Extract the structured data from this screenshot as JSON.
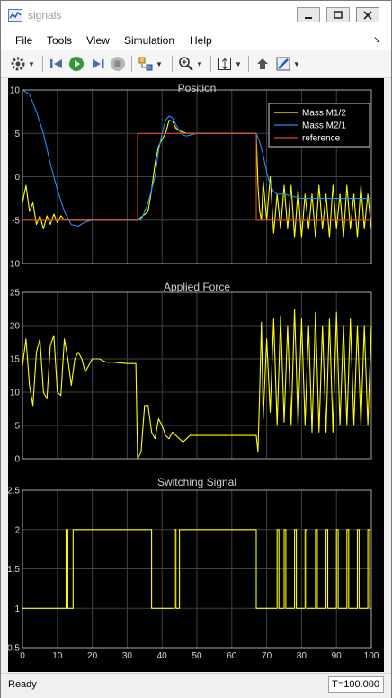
{
  "window": {
    "title": "signals"
  },
  "menu": [
    {
      "id": "file",
      "label": "File"
    },
    {
      "id": "tools",
      "label": "Tools"
    },
    {
      "id": "view",
      "label": "View"
    },
    {
      "id": "simulation",
      "label": "Simulation"
    },
    {
      "id": "help",
      "label": "Help"
    }
  ],
  "toolbar_icons": [
    "gear-icon",
    "step-back-icon",
    "run-icon",
    "step-forward-icon",
    "stop-icon",
    "layout-icon",
    "zoom-icon",
    "autoscale-icon",
    "highlight-block-icon",
    "style-icon"
  ],
  "colors": {
    "yellow": "#ffff00",
    "blue": "#1e90ff",
    "red": "#e0462b",
    "grid": "#404040",
    "axes_bg": "#000000"
  },
  "chart_data": [
    {
      "type": "line",
      "title": "Position",
      "xlim": [
        0,
        100
      ],
      "ylim": [
        -10,
        10
      ],
      "xticks": [
        0,
        10,
        20,
        30,
        40,
        50,
        60,
        70,
        80,
        90,
        100
      ],
      "yticks": [
        -10,
        -5,
        0,
        5,
        10
      ],
      "grid": true,
      "legend": "top-right",
      "series": [
        {
          "name": "Mass M1/2",
          "color": "#ffff00",
          "points": [
            [
              0,
              -3
            ],
            [
              1,
              -1
            ],
            [
              2,
              -4
            ],
            [
              3,
              -3
            ],
            [
              4,
              -5.5
            ],
            [
              5,
              -4.5
            ],
            [
              6,
              -6
            ],
            [
              7,
              -4.5
            ],
            [
              8,
              -5.5
            ],
            [
              9,
              -4.3
            ],
            [
              10,
              -5.3
            ],
            [
              11,
              -4.5
            ],
            [
              12,
              -5
            ],
            [
              14,
              -5
            ],
            [
              20,
              -5
            ],
            [
              33,
              -5
            ],
            [
              36,
              -4
            ],
            [
              37,
              -1.5
            ],
            [
              38,
              1.5
            ],
            [
              39,
              3.5
            ],
            [
              40,
              4.3
            ],
            [
              41,
              5
            ],
            [
              42,
              6.5
            ],
            [
              43,
              6.4
            ],
            [
              44,
              5.6
            ],
            [
              45,
              5.3
            ],
            [
              47,
              5
            ],
            [
              50,
              5
            ],
            [
              67,
              5
            ],
            [
              67.5,
              -1
            ],
            [
              68,
              -4
            ],
            [
              68.5,
              -5
            ],
            [
              69,
              -0.5
            ],
            [
              70,
              -5
            ],
            [
              71,
              0
            ],
            [
              72,
              -6.5
            ],
            [
              73,
              -2
            ],
            [
              74,
              -6
            ],
            [
              75,
              -1
            ],
            [
              76,
              -6
            ],
            [
              77,
              -1
            ],
            [
              78,
              -7
            ],
            [
              79,
              -1.5
            ],
            [
              80,
              -7
            ],
            [
              81,
              -2
            ],
            [
              82,
              -6
            ],
            [
              83,
              -2
            ],
            [
              84,
              -7
            ],
            [
              85,
              -1
            ],
            [
              86,
              -6
            ],
            [
              87,
              -2
            ],
            [
              88,
              -7
            ],
            [
              89,
              -1
            ],
            [
              90,
              -6
            ],
            [
              91,
              -2
            ],
            [
              92,
              -7
            ],
            [
              93,
              -1
            ],
            [
              94,
              -6
            ],
            [
              95,
              -2
            ],
            [
              96,
              -7
            ],
            [
              97,
              -1
            ],
            [
              98,
              -6
            ],
            [
              99,
              -2
            ],
            [
              100,
              -6
            ]
          ]
        },
        {
          "name": "Mass M2/1",
          "color": "#1e90ff",
          "points": [
            [
              0,
              10
            ],
            [
              2,
              9.5
            ],
            [
              4,
              7.5
            ],
            [
              6,
              5
            ],
            [
              8,
              1.5
            ],
            [
              10,
              -1.5
            ],
            [
              12,
              -4
            ],
            [
              14,
              -5.5
            ],
            [
              16,
              -5.7
            ],
            [
              18,
              -5.2
            ],
            [
              20,
              -5
            ],
            [
              25,
              -5
            ],
            [
              33,
              -5
            ],
            [
              34,
              -5
            ],
            [
              36,
              -3
            ],
            [
              38,
              0
            ],
            [
              39,
              3
            ],
            [
              40,
              5
            ],
            [
              41,
              6.5
            ],
            [
              42,
              7
            ],
            [
              43,
              6.8
            ],
            [
              44,
              6
            ],
            [
              45,
              5.3
            ],
            [
              46,
              4.8
            ],
            [
              47,
              4.7
            ],
            [
              48,
              4.8
            ],
            [
              50,
              5
            ],
            [
              55,
              5
            ],
            [
              67,
              5
            ],
            [
              68,
              4
            ],
            [
              69,
              2.5
            ],
            [
              70,
              0.5
            ],
            [
              71,
              -1
            ],
            [
              72,
              -1.7
            ],
            [
              73,
              -2
            ],
            [
              75,
              -2
            ],
            [
              80,
              -2.5
            ],
            [
              90,
              -2.5
            ],
            [
              100,
              -2.5
            ]
          ]
        },
        {
          "name": "reference",
          "color": "#e0462b",
          "points": [
            [
              0,
              -5
            ],
            [
              33,
              -5
            ],
            [
              33,
              5
            ],
            [
              67,
              5
            ],
            [
              67,
              -5
            ],
            [
              100,
              -5
            ]
          ]
        }
      ]
    },
    {
      "type": "line",
      "title": "Applied Force",
      "xlim": [
        0,
        100
      ],
      "ylim": [
        0,
        25
      ],
      "xticks": [
        0,
        10,
        20,
        30,
        40,
        50,
        60,
        70,
        80,
        90,
        100
      ],
      "yticks": [
        0,
        5,
        10,
        15,
        20,
        25
      ],
      "grid": true,
      "series": [
        {
          "name": "",
          "color": "#ffff00",
          "points": [
            [
              0,
              14
            ],
            [
              1,
              18
            ],
            [
              2,
              11
            ],
            [
              3,
              8
            ],
            [
              4,
              16
            ],
            [
              5,
              18
            ],
            [
              6,
              10
            ],
            [
              7,
              9
            ],
            [
              8,
              17
            ],
            [
              9,
              18.5
            ],
            [
              10,
              10
            ],
            [
              11,
              9.5
            ],
            [
              12,
              18
            ],
            [
              13,
              15
            ],
            [
              14,
              11
            ],
            [
              15,
              15
            ],
            [
              16,
              16
            ],
            [
              17,
              15
            ],
            [
              18,
              13
            ],
            [
              20,
              15
            ],
            [
              22,
              15
            ],
            [
              24,
              14.5
            ],
            [
              26,
              14.5
            ],
            [
              30,
              14.3
            ],
            [
              32,
              14.3
            ],
            [
              32.5,
              14.3
            ],
            [
              33,
              0
            ],
            [
              34,
              1
            ],
            [
              35,
              8
            ],
            [
              36,
              8
            ],
            [
              37,
              4
            ],
            [
              38,
              3
            ],
            [
              39,
              6
            ],
            [
              40,
              5
            ],
            [
              41,
              3.5
            ],
            [
              42,
              3
            ],
            [
              43,
              4
            ],
            [
              44,
              3.5
            ],
            [
              45,
              3
            ],
            [
              46,
              2.5
            ],
            [
              47,
              3
            ],
            [
              48,
              3.5
            ],
            [
              50,
              3.5
            ],
            [
              55,
              3.5
            ],
            [
              60,
              3.5
            ],
            [
              66,
              3.5
            ],
            [
              67,
              3.5
            ],
            [
              67.5,
              1
            ],
            [
              68,
              10
            ],
            [
              68.5,
              20.5
            ],
            [
              69,
              6
            ],
            [
              70,
              18
            ],
            [
              71,
              7
            ],
            [
              72,
              21
            ],
            [
              73,
              5
            ],
            [
              74,
              21.5
            ],
            [
              75,
              5.5
            ],
            [
              76,
              20
            ],
            [
              77,
              5
            ],
            [
              78,
              22.5
            ],
            [
              79,
              5
            ],
            [
              80,
              21
            ],
            [
              81,
              5
            ],
            [
              82,
              20
            ],
            [
              83,
              4
            ],
            [
              84,
              22
            ],
            [
              85,
              4
            ],
            [
              86,
              20
            ],
            [
              87,
              4
            ],
            [
              88,
              21
            ],
            [
              89,
              4
            ],
            [
              90,
              22
            ],
            [
              91,
              5
            ],
            [
              92,
              20
            ],
            [
              93,
              5
            ],
            [
              94,
              21
            ],
            [
              95,
              5
            ],
            [
              96,
              20
            ],
            [
              97,
              5
            ],
            [
              98,
              20
            ],
            [
              99,
              5
            ],
            [
              100,
              20
            ]
          ]
        }
      ]
    },
    {
      "type": "line",
      "title": "Switching Signal",
      "xlim": [
        0,
        100
      ],
      "ylim": [
        0.5,
        2.5
      ],
      "xticks": [
        0,
        10,
        20,
        30,
        40,
        50,
        60,
        70,
        80,
        90,
        100
      ],
      "yticks": [
        0.5,
        1,
        1.5,
        2,
        2.5
      ],
      "grid": true,
      "series": [
        {
          "name": "",
          "color": "#ffff00",
          "points": [
            [
              0,
              1
            ],
            [
              12.5,
              1
            ],
            [
              12.5,
              2
            ],
            [
              13,
              2
            ],
            [
              13,
              1
            ],
            [
              14.5,
              1
            ],
            [
              14.5,
              2
            ],
            [
              37,
              2
            ],
            [
              37,
              1
            ],
            [
              43.5,
              1
            ],
            [
              43.5,
              2
            ],
            [
              44,
              2
            ],
            [
              44,
              1
            ],
            [
              45,
              1
            ],
            [
              45,
              2
            ],
            [
              67,
              2
            ],
            [
              67,
              1
            ],
            [
              73,
              1
            ],
            [
              73,
              2
            ],
            [
              73.5,
              2
            ],
            [
              73.5,
              1
            ],
            [
              75,
              1
            ],
            [
              75,
              2
            ],
            [
              75.5,
              2
            ],
            [
              75.5,
              1
            ],
            [
              78,
              1
            ],
            [
              78,
              2
            ],
            [
              78.5,
              2
            ],
            [
              78.5,
              1
            ],
            [
              81,
              1
            ],
            [
              81,
              2
            ],
            [
              81.5,
              2
            ],
            [
              81.5,
              1
            ],
            [
              84,
              1
            ],
            [
              84,
              2
            ],
            [
              84.5,
              2
            ],
            [
              84.5,
              1
            ],
            [
              87,
              1
            ],
            [
              87,
              2
            ],
            [
              87.5,
              2
            ],
            [
              87.5,
              1
            ],
            [
              90,
              1
            ],
            [
              90,
              2
            ],
            [
              90.5,
              2
            ],
            [
              90.5,
              1
            ],
            [
              93,
              1
            ],
            [
              93,
              2
            ],
            [
              93.5,
              2
            ],
            [
              93.5,
              1
            ],
            [
              96,
              1
            ],
            [
              96,
              2
            ],
            [
              96.5,
              2
            ],
            [
              96.5,
              1
            ],
            [
              99,
              1
            ],
            [
              99,
              2
            ],
            [
              99.5,
              2
            ],
            [
              99.5,
              1
            ],
            [
              100,
              1
            ]
          ]
        }
      ]
    }
  ],
  "status": {
    "text": "Ready",
    "time": "T=100.000"
  }
}
